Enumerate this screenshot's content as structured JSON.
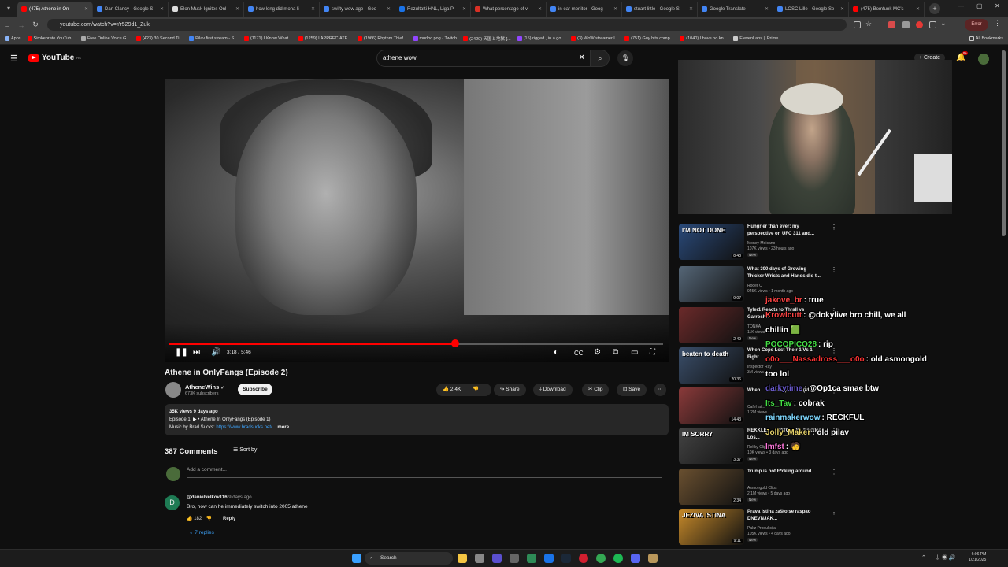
{
  "browser": {
    "tabs": [
      {
        "label": "(475) Athene in On",
        "active": true,
        "color": "#ff0000"
      },
      {
        "label": "Dan Clancy - Google S",
        "color": "#4285f4"
      },
      {
        "label": "Elon Musk Ignites Onl",
        "color": "#dddddd"
      },
      {
        "label": "how long did mona li",
        "color": "#4285f4"
      },
      {
        "label": "swifty wow age - Goo",
        "color": "#4285f4"
      },
      {
        "label": "Rezultatti HNL, Liga P",
        "color": "#1a73e8"
      },
      {
        "label": "What percentage of v",
        "color": "#d93025"
      },
      {
        "label": "in ear monitor - Goog",
        "color": "#4285f4"
      },
      {
        "label": "stuart little - Google S",
        "color": "#4285f4"
      },
      {
        "label": "Google Translate",
        "color": "#4285f4"
      },
      {
        "label": "LOSC Lille - Google Se",
        "color": "#4285f4"
      },
      {
        "label": "(475) Bomfunk MC's",
        "color": "#ff0000"
      }
    ],
    "url": "youtube.com/watch?v=Yr529d1_Zuk",
    "error_label": "Error",
    "bookmarks": [
      {
        "label": "Apps",
        "color": "#8ab4f8"
      },
      {
        "label": "Simkebrate YouTub...",
        "color": "#ff0000"
      },
      {
        "label": "Free Online Voice G...",
        "color": "#aaaaaa"
      },
      {
        "label": "(423) 30 Second Ti...",
        "color": "#ff0000"
      },
      {
        "label": "Pilav first stream - S...",
        "color": "#4285f4"
      },
      {
        "label": "(1171) I Know What...",
        "color": "#ff0000"
      },
      {
        "label": "(1259) I APPRECIATE...",
        "color": "#ff0000"
      },
      {
        "label": "(1966) Rhythm Thief...",
        "color": "#ff0000"
      },
      {
        "label": "murloc pog - Twitch",
        "color": "#9146ff"
      },
      {
        "label": "(2420) 天国と地獄 [...",
        "color": "#ff0000"
      },
      {
        "label": "(15) rigged , in a go...",
        "color": "#9146ff"
      },
      {
        "label": "(3) WoW streamer l...",
        "color": "#ff0000"
      },
      {
        "label": "(751) Guy hits comp...",
        "color": "#ff0000"
      },
      {
        "label": "(1040) I have no kn...",
        "color": "#ff0000"
      },
      {
        "label": "ElevenLabs || Prime...",
        "color": "#cccccc"
      }
    ],
    "all_bookmarks": "All Bookmarks"
  },
  "youtube": {
    "logo": "YouTube",
    "logo_region": "RS",
    "search_query": "athene wow",
    "create_label": "Create",
    "notif_count": "9+"
  },
  "player": {
    "time": "3:18 / 5:46",
    "progress": 0.573
  },
  "video": {
    "title": "Athene in OnlyFangs (Episode 2)",
    "channel": "AtheneWins",
    "subscribers": "673K subscribers",
    "subscribe_label": "Subscribe",
    "likes": "2.4K",
    "share": "Share",
    "download": "Download",
    "clip": "Clip",
    "save": "Save",
    "desc_line1": "35K views  9 days ago",
    "desc_line2": "Episode 1:  ▶ • Athene In OnlyFangs (Episode 1)",
    "desc_line3_prefix": "Music by Brad Sucks: ",
    "desc_link": "https://www.bradsucks.net/",
    "desc_more": " ...more"
  },
  "comments": {
    "count": "387 Comments",
    "sort": "Sort by",
    "placeholder": "Add a comment...",
    "first": {
      "user": "@danielvelkov116",
      "time": "9 days ago",
      "text": "Bro, how can he immediately switch into 2005 athene",
      "likes": "182",
      "reply": "Reply",
      "replies": "7 replies",
      "avatar_letter": "D"
    }
  },
  "recommendations": [
    {
      "title": "Hungrier than ever: my perspective on UFC 311 and...",
      "channel": "Money Moicano",
      "meta": "107K views • 23 hours ago",
      "badge": "New",
      "duration": "8:48",
      "thumb_text": "I'M NOT DONE",
      "color": "#2a4a7a"
    },
    {
      "title": "What 300 days of Growing Thicker Wrists and Hands did t...",
      "channel": "Roger C",
      "meta": "945K views • 1 month ago",
      "badge": "",
      "duration": "9:07",
      "thumb_text": "",
      "color": "#556677"
    },
    {
      "title": "Tyler1 Reacts to Thrall vs Garrosh...",
      "channel": "TONKA",
      "meta": "11K views",
      "badge": "New",
      "duration": "2:49",
      "thumb_text": "",
      "color": "#6b2a2a"
    },
    {
      "title": "When Cops Lost Their 1 Vs 1 Fight",
      "channel": "Inspector Ray",
      "meta": "3M views",
      "badge": "",
      "duration": "20:36",
      "thumb_text": "beaten to death",
      "color": "#3a4e6a"
    },
    {
      "title": "When ... Celebrity Crush (Idol)",
      "channel": "CafeHat...",
      "meta": "1.2M views",
      "badge": "",
      "duration": "14:43",
      "thumb_text": "",
      "color": "#8a3a3a"
    },
    {
      "title": "REKKLES ... RATONES - Rekkles Los...",
      "channel": "Rekky Clips",
      "meta": "10K views • 3 days ago",
      "badge": "New",
      "duration": "3:37",
      "thumb_text": "IM SORRY",
      "color": "#444444"
    },
    {
      "title": "Trump is not F*cking around..",
      "channel": "Asmongold Clips",
      "meta": "2.1M views • 5 days ago",
      "badge": "New",
      "duration": "2:34",
      "thumb_text": "",
      "color": "#6a5030"
    },
    {
      "title": "Prava istina zašto se raspao DNEVNJAK...",
      "channel": "Pakz Produkcija",
      "meta": "105K views • 4 days ago",
      "badge": "New",
      "duration": "9:11",
      "thumb_text": "JEZIVA ISTINA",
      "color": "#c78a2a"
    }
  ],
  "chat": [
    {
      "user": "jakove_br",
      "msg": ": true",
      "color": "#ff4444"
    },
    {
      "user": "Krowlcutt",
      "msg": ": @dokylive bro chill, we all",
      "color": "#ff4444"
    },
    {
      "user": "",
      "msg": "chillin 🟩",
      "color": "#ffffff"
    },
    {
      "user": "POCOPICO28",
      "msg": ": rip",
      "color": "#44dd44"
    },
    {
      "user": "o0o___Nassadross___o0o",
      "msg": ": old asmongold",
      "color": "#ff3333"
    },
    {
      "user": "",
      "msg": "too lol",
      "color": "#ffffff"
    },
    {
      "user": "darkytime",
      "msg": ": @Op1ca smae btw",
      "color": "#6a5acd"
    },
    {
      "user": "Its_Tav",
      "msg": ": cobrak",
      "color": "#44dd44"
    },
    {
      "user": "rainmakerwow",
      "msg": ": RECKFUL",
      "color": "#7fd9ff"
    },
    {
      "user": "Jolly_Maker",
      "msg": ": old pilav",
      "color": "#e8d36a"
    },
    {
      "user": "lmfst",
      "msg": ": 🧑",
      "color": "#ff77dd"
    }
  ],
  "taskbar": {
    "search": "Search",
    "time": "6:06 PM",
    "date": "1/21/2025"
  }
}
